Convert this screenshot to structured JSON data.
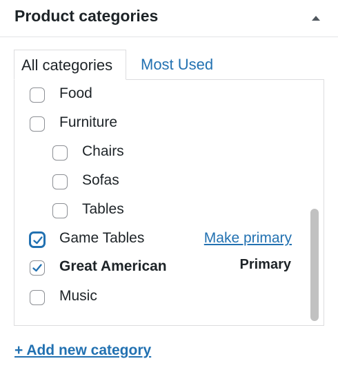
{
  "panel": {
    "title": "Product categories",
    "toggle_icon": "triangle-up-icon"
  },
  "tabs": [
    {
      "label": "All categories",
      "active": true
    },
    {
      "label": "Most Used",
      "active": false
    }
  ],
  "categories": [
    {
      "label": "Food",
      "checked": false,
      "level": 0
    },
    {
      "label": "Furniture",
      "checked": false,
      "level": 0
    },
    {
      "label": "Chairs",
      "checked": false,
      "level": 1
    },
    {
      "label": "Sofas",
      "checked": false,
      "level": 1
    },
    {
      "label": "Tables",
      "checked": false,
      "level": 1
    },
    {
      "label": "Game Tables",
      "checked": true,
      "level": 0,
      "action": "Make primary"
    },
    {
      "label": "Great American",
      "checked": true,
      "level": 0,
      "status": "Primary"
    },
    {
      "label": "Music",
      "checked": false,
      "level": 0
    }
  ],
  "add_new_label": "+ Add new category",
  "colors": {
    "link": "#2271b1",
    "text": "#1d2327",
    "border": "#dcdcde"
  }
}
